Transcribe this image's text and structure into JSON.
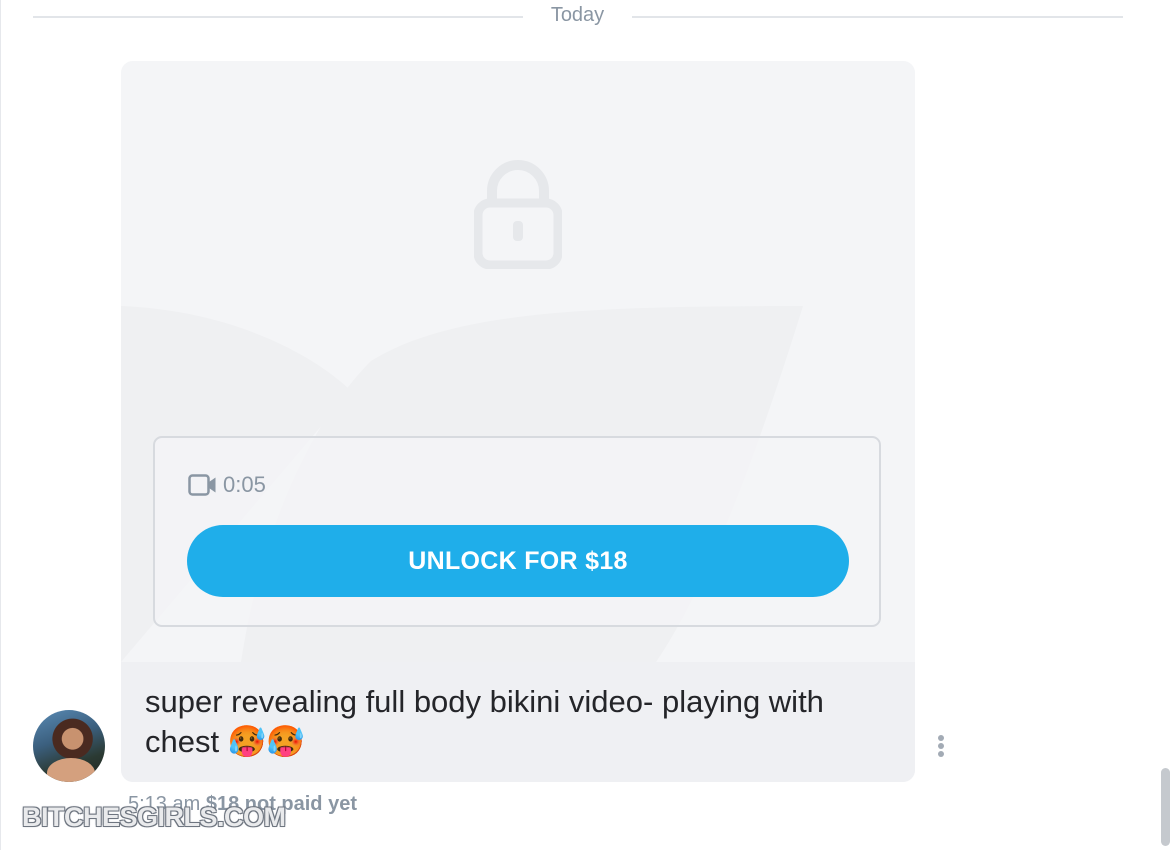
{
  "divider": {
    "label": "Today"
  },
  "message": {
    "media": {
      "lock_icon": "lock-icon",
      "video_icon": "video-camera-icon",
      "duration": "0:05",
      "unlock_label": "UNLOCK FOR $18"
    },
    "caption": "super revealing full body bikini video- playing with chest 🥵🥵",
    "time": "5:13 am",
    "price_status": "$18 not paid yet",
    "more_icon": "more-vertical-icon",
    "avatar_icon": "avatar"
  },
  "watermark": {
    "text": "BITCHESGIRLS.COM"
  },
  "colors": {
    "accent": "#1faeea",
    "muted_text": "#8a96a3",
    "card_bg": "#f4f5f7",
    "caption_bg": "#eff0f3"
  }
}
